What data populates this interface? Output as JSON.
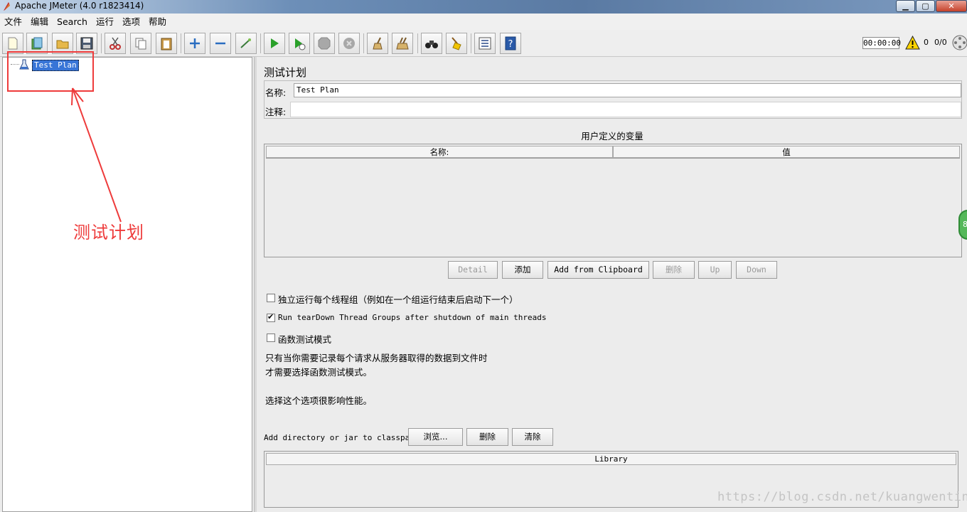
{
  "window": {
    "title": "Apache JMeter (4.0 r1823414)"
  },
  "menu": [
    "文件",
    "编辑",
    "Search",
    "运行",
    "选项",
    "帮助"
  ],
  "toolbar": {
    "buttons": [
      "new",
      "templates",
      "open",
      "save",
      "cut",
      "copy",
      "paste",
      "expand",
      "collapse",
      "toggle",
      "start",
      "start-no-pause",
      "stop",
      "shutdown",
      "clear",
      "clear-all",
      "search",
      "reset-search",
      "function-helper",
      "help"
    ],
    "timer": "00:00:00",
    "error_count": "0",
    "thread_count": "0/0"
  },
  "tree": {
    "root_label": "Test Plan"
  },
  "annotation": {
    "text": "测试计划",
    "color": "#ee3b3b"
  },
  "test_plan": {
    "title": "测试计划",
    "name_label": "名称:",
    "name_value": "Test Plan",
    "comment_label": "注释:",
    "comment_value": "",
    "vars_title": "用户定义的变量",
    "vars_columns": [
      "名称:",
      "值"
    ],
    "buttons": {
      "detail": "Detail",
      "add": "添加",
      "add_clipboard": "Add from Clipboard",
      "delete": "删除",
      "up": "Up",
      "down": "Down"
    },
    "options": [
      {
        "label": "独立运行每个线程组（例如在一个组运行结束后启动下一个）",
        "checked": false
      },
      {
        "label": "Run tearDown Thread Groups after shutdown of main threads",
        "checked": true
      },
      {
        "label": "函数测试模式",
        "checked": false
      }
    ],
    "info": [
      "只有当你需要记录每个请求从服务器取得的数据到文件时",
      "才需要选择函数测试模式。",
      "选择这个选项很影响性能。"
    ],
    "classpath_label": "Add directory or jar to classpath",
    "classpath_buttons": {
      "browse": "浏览...",
      "delete": "删除",
      "clear": "清除"
    },
    "library_header": "Library"
  },
  "side_badge": "8",
  "watermark": "https://blog.csdn.net/kuangwenting"
}
